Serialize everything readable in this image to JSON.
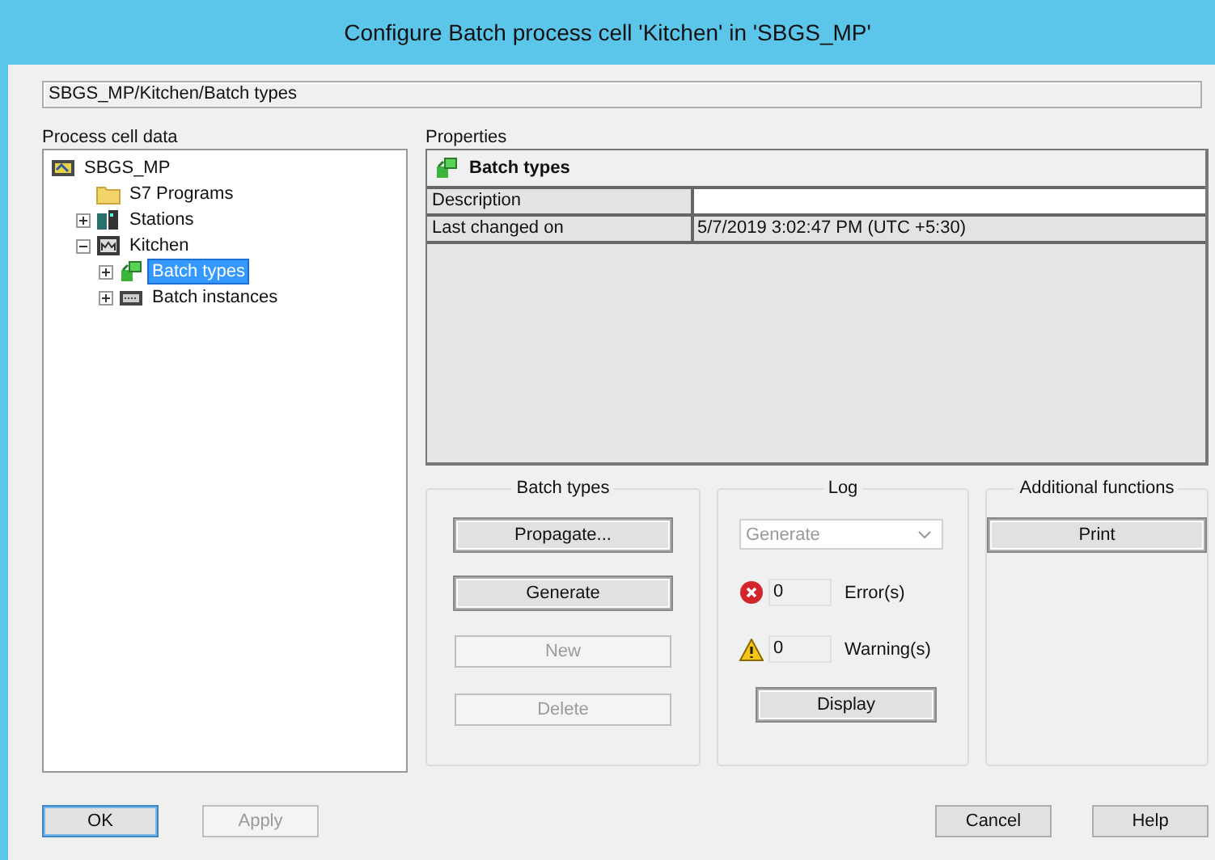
{
  "window": {
    "title": "Configure Batch process cell 'Kitchen' in 'SBGS_MP'"
  },
  "path": "SBGS_MP/Kitchen/Batch types",
  "tree": {
    "label": "Process cell data",
    "items": [
      {
        "label": "SBGS_MP",
        "kind": "project",
        "selected": false,
        "children": [
          {
            "label": "S7 Programs",
            "kind": "folder",
            "selected": false
          },
          {
            "label": "Stations",
            "kind": "stations",
            "expanded": false,
            "selected": false
          },
          {
            "label": "Kitchen",
            "kind": "cell",
            "expanded": true,
            "selected": false,
            "children": [
              {
                "label": "Batch types",
                "kind": "batchtypes",
                "expanded": false,
                "selected": true
              },
              {
                "label": "Batch instances",
                "kind": "instances",
                "expanded": false,
                "selected": false
              }
            ]
          }
        ]
      }
    ]
  },
  "properties": {
    "label": "Properties",
    "header": "Batch types",
    "rows": [
      {
        "name": "Description"
      },
      {
        "name": "Last changed on",
        "value": "5/7/2019 3:02:47 PM (UTC +5:30)"
      }
    ]
  },
  "groups": {
    "batch_types": {
      "title": "Batch types",
      "buttons": [
        {
          "label": "Propagate...",
          "disabled": false
        },
        {
          "label": "Generate",
          "disabled": false
        },
        {
          "label": "New",
          "disabled": true
        },
        {
          "label": "Delete",
          "disabled": true
        }
      ]
    },
    "log": {
      "title": "Log",
      "dropdown": {
        "value": "Generate",
        "disabled": true
      },
      "errors": {
        "count": "0",
        "label": "Error(s)"
      },
      "warnings": {
        "count": "0",
        "label": "Warning(s)"
      },
      "button": {
        "label": "Display",
        "disabled": false
      }
    },
    "additional": {
      "title": "Additional functions",
      "buttons": [
        {
          "label": "Print",
          "disabled": false
        }
      ]
    }
  },
  "footer": {
    "left": [
      {
        "label": "OK",
        "disabled": false,
        "default": true
      },
      {
        "label": "Apply",
        "disabled": true,
        "default": false
      }
    ],
    "right": [
      {
        "label": "Cancel",
        "disabled": false,
        "default": false
      },
      {
        "label": "Help",
        "disabled": false,
        "default": false
      }
    ]
  }
}
